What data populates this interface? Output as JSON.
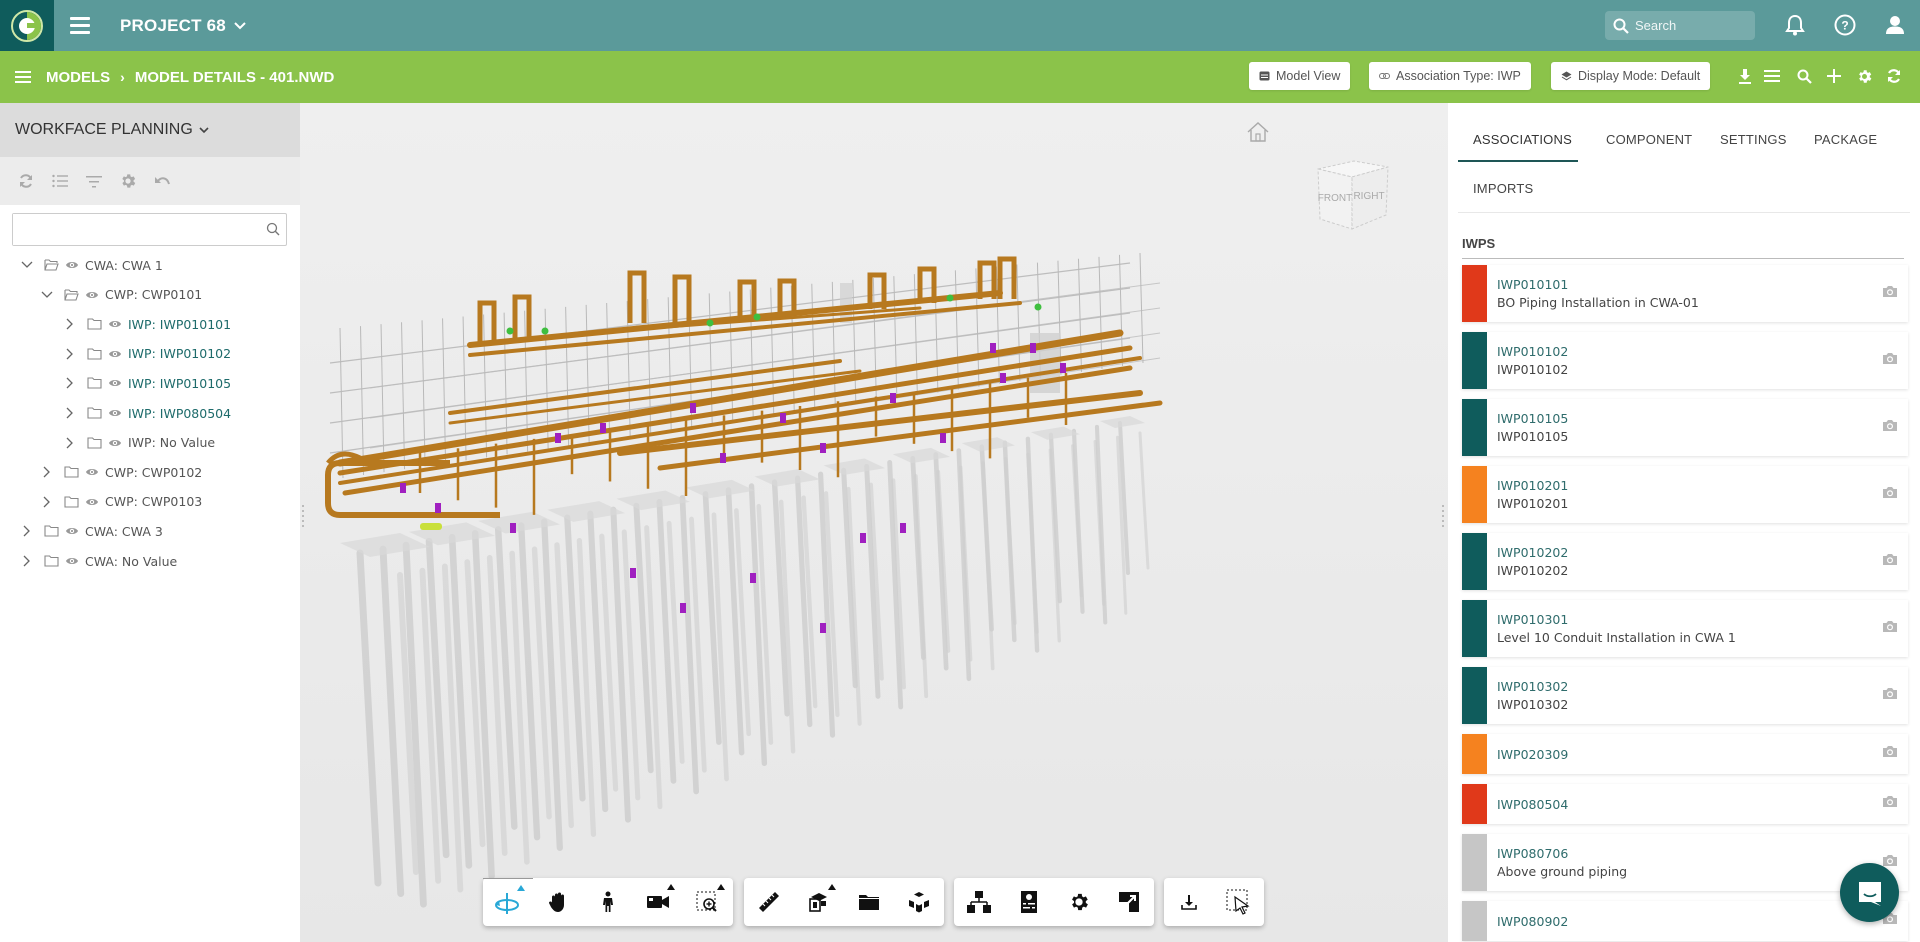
{
  "topbar": {
    "logo": "app-logo",
    "project_title": "PROJECT 68",
    "search_placeholder": "Search",
    "icons": [
      "bell-icon",
      "help-icon",
      "user-icon"
    ]
  },
  "subbar": {
    "breadcrumb": [
      "MODELS",
      "MODEL DETAILS - 401.NWD"
    ],
    "buttons": {
      "model_view": "Model View",
      "association_type": "Association Type: IWP",
      "display_mode": "Display Mode: Default"
    },
    "icons": [
      "download-icon",
      "list-icon",
      "search-icon",
      "plus-icon",
      "gear-icon",
      "refresh-icon"
    ]
  },
  "left_panel": {
    "header": "WORKFACE PLANNING",
    "tools": [
      "refresh-icon",
      "list-icon",
      "filter-icon",
      "gear-icon",
      "undo-icon"
    ],
    "search_value": "",
    "tree": [
      {
        "label": "CWA: CWA 1",
        "level": 0,
        "expanded": true,
        "kind": "cwa"
      },
      {
        "label": "CWP: CWP0101",
        "level": 1,
        "expanded": true,
        "kind": "cwp"
      },
      {
        "label": "IWP: IWP010101",
        "level": 2,
        "expanded": false,
        "kind": "iwp"
      },
      {
        "label": "IWP: IWP010102",
        "level": 2,
        "expanded": false,
        "kind": "iwp"
      },
      {
        "label": "IWP: IWP010105",
        "level": 2,
        "expanded": false,
        "kind": "iwp"
      },
      {
        "label": "IWP: IWP080504",
        "level": 2,
        "expanded": false,
        "kind": "iwp"
      },
      {
        "label": "IWP: No Value",
        "level": 2,
        "expanded": false,
        "kind": "novalue"
      },
      {
        "label": "CWP: CWP0102",
        "level": 1,
        "expanded": false,
        "kind": "cwp"
      },
      {
        "label": "CWP: CWP0103",
        "level": 1,
        "expanded": false,
        "kind": "cwp"
      },
      {
        "label": "CWA: CWA 3",
        "level": 0,
        "expanded": false,
        "kind": "cwa"
      },
      {
        "label": "CWA: No Value",
        "level": 0,
        "expanded": false,
        "kind": "cwa"
      }
    ]
  },
  "viewer": {
    "viewcube_faces": [
      "FRONT",
      "RIGHT"
    ],
    "toolbar_groups": [
      [
        {
          "name": "orbit-icon",
          "active": true,
          "caret": true
        },
        {
          "name": "pan-hand-icon",
          "active": false,
          "caret": false
        },
        {
          "name": "walk-person-icon",
          "active": false,
          "caret": false
        },
        {
          "name": "camera-icon",
          "active": false,
          "caret": true
        },
        {
          "name": "zoom-window-icon",
          "active": false,
          "caret": true
        }
      ],
      [
        {
          "name": "measure-ruler-icon",
          "active": false,
          "caret": false
        },
        {
          "name": "section-box-icon",
          "active": false,
          "caret": true
        },
        {
          "name": "folder-icon",
          "active": false,
          "caret": false
        },
        {
          "name": "explode-cubes-icon",
          "active": false,
          "caret": false
        }
      ],
      [
        {
          "name": "model-tree-icon",
          "active": false,
          "caret": false
        },
        {
          "name": "properties-icon",
          "active": false,
          "caret": false
        },
        {
          "name": "settings-gear-icon",
          "active": false,
          "caret": false
        },
        {
          "name": "fullscreen-icon",
          "active": false,
          "caret": false
        }
      ],
      [
        {
          "name": "download-icon",
          "active": false,
          "caret": false
        },
        {
          "name": "select-window-icon",
          "active": false,
          "caret": false
        }
      ]
    ]
  },
  "right_panel": {
    "tabs": [
      "ASSOCIATIONS",
      "COMPONENT",
      "SETTINGS",
      "PACKAGE",
      "IMPORTS"
    ],
    "active_tab": "ASSOCIATIONS",
    "section_title": "IWPS",
    "iwps": [
      {
        "id": "IWP010101",
        "desc": "BO Piping Installation in CWA-01",
        "color": "#e0391a"
      },
      {
        "id": "IWP010102",
        "desc": "IWP010102",
        "color": "#0f5c5c"
      },
      {
        "id": "IWP010105",
        "desc": "IWP010105",
        "color": "#0f5c5c"
      },
      {
        "id": "IWP010201",
        "desc": "IWP010201",
        "color": "#f5821f"
      },
      {
        "id": "IWP010202",
        "desc": "IWP010202",
        "color": "#0f5c5c"
      },
      {
        "id": "IWP010301",
        "desc": "Level 10 Conduit Installation in CWA 1",
        "color": "#0f5c5c"
      },
      {
        "id": "IWP010302",
        "desc": "IWP010302",
        "color": "#0f5c5c"
      },
      {
        "id": "IWP020309",
        "desc": "",
        "color": "#f5821f"
      },
      {
        "id": "IWP080504",
        "desc": "",
        "color": "#e0391a"
      },
      {
        "id": "IWP080706",
        "desc": "Above ground piping",
        "color": "#c6c6c6"
      },
      {
        "id": "IWP080902",
        "desc": "",
        "color": "#c6c6c6"
      }
    ]
  },
  "chat": {
    "icon": "chat-icon"
  }
}
